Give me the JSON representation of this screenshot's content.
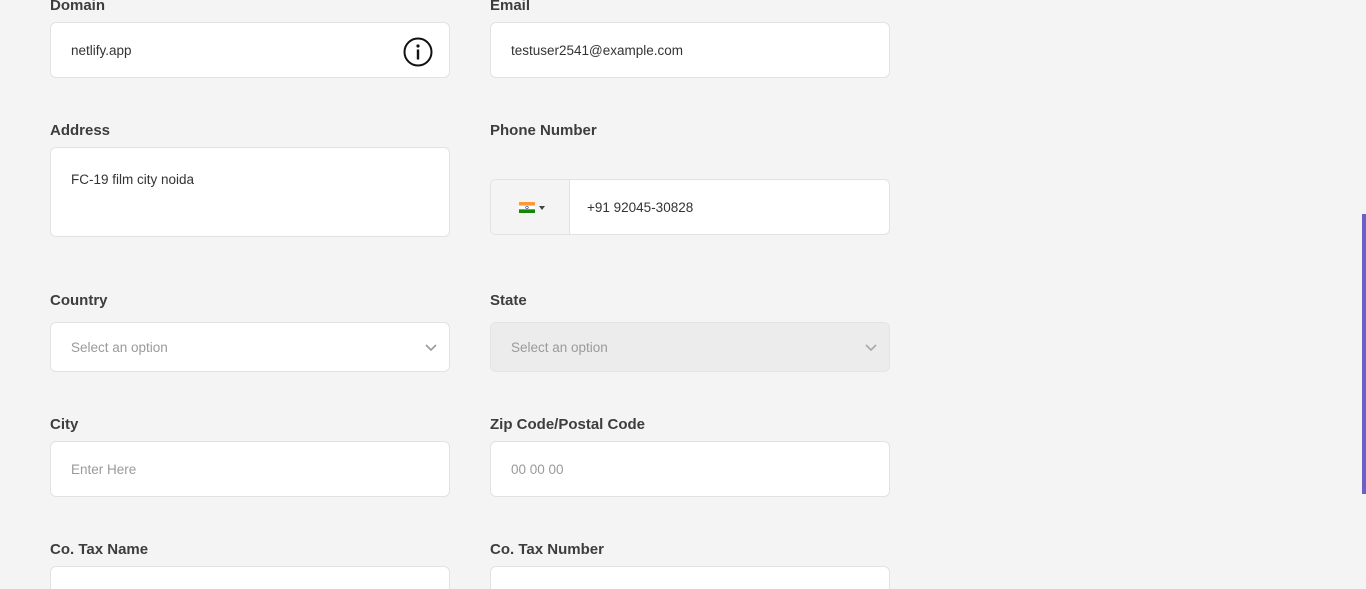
{
  "form": {
    "domain": {
      "label": "Domain",
      "value": "netlify.app"
    },
    "email": {
      "label": "Email",
      "value": "testuser2541@example.com"
    },
    "address": {
      "label": "Address",
      "value": "FC-19 film city noida"
    },
    "phone": {
      "label": "Phone Number",
      "value": "+91 92045-30828",
      "country_flag": "india-flag-icon"
    },
    "country": {
      "label": "Country",
      "placeholder": "Select an option"
    },
    "state": {
      "label": "State",
      "placeholder": "Select an option",
      "disabled": true
    },
    "city": {
      "label": "City",
      "placeholder": "Enter Here"
    },
    "zip": {
      "label": "Zip Code/Postal Code",
      "placeholder": "00 00 00"
    },
    "tax_name": {
      "label": "Co. Tax Name"
    },
    "tax_number": {
      "label": "Co. Tax Number"
    }
  },
  "colors": {
    "background": "#f4f4f4",
    "field_bg": "#ffffff",
    "field_border": "#e2e2e2",
    "disabled_bg": "#ececec",
    "scrollbar_accent": "#6c5fc7"
  },
  "icons": {
    "domain_info": "info-icon",
    "select_chevron": "chevron-down-icon"
  }
}
